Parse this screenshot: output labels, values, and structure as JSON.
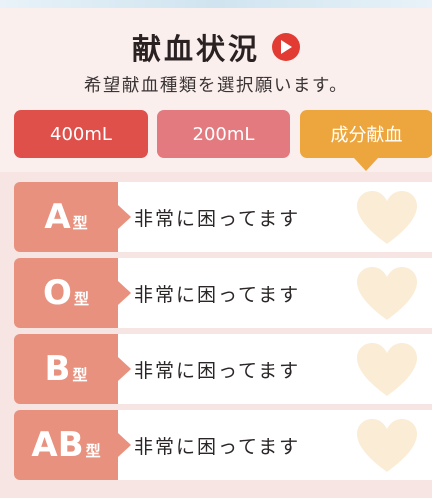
{
  "header": {
    "title": "献血状況",
    "subtitle": "希望献血種類を選択願います。",
    "play_icon": "play-circle-icon",
    "accent_color": "#e23b33"
  },
  "tabs": [
    {
      "label": "400mL",
      "color": "#e0504a",
      "selected": false
    },
    {
      "label": "200mL",
      "color": "#e37a7f",
      "selected": false
    },
    {
      "label": "成分献血",
      "color": "#eda63d",
      "selected": true
    }
  ],
  "blood_types": [
    {
      "letter": "A",
      "suffix": "型",
      "status": "非常に困ってます",
      "icon": "heart-icon"
    },
    {
      "letter": "O",
      "suffix": "型",
      "status": "非常に困ってます",
      "icon": "heart-icon"
    },
    {
      "letter": "B",
      "suffix": "型",
      "status": "非常に困ってます",
      "icon": "heart-icon"
    },
    {
      "letter": "AB",
      "suffix": "型",
      "status": "非常に困ってます",
      "icon": "heart-icon"
    }
  ],
  "colors": {
    "badge": "#e7917e",
    "heart": "#fbecd5",
    "background": "#fbefee"
  }
}
